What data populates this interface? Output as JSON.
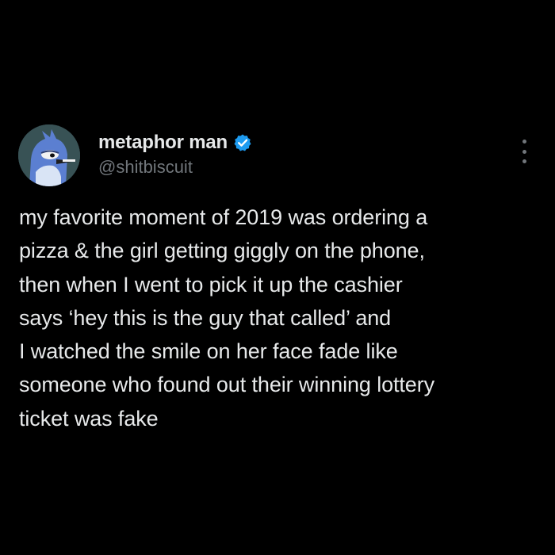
{
  "author": {
    "display_name": "metaphor man",
    "handle": "@shitbiscuit",
    "verified_badge_icon": "verified-check-icon",
    "verified_color": "#1d9bf0"
  },
  "menu": {
    "icon": "more-options-icon"
  },
  "tweet": {
    "lines": [
      "my favorite moment of 2019 was ordering a",
      "pizza & the girl getting giggly on the phone,",
      "then when I went to pick it up the cashier",
      "says ‘hey this is the guy that called’ and",
      "I watched the smile on her face fade like",
      "someone who found out their winning lottery",
      "ticket was fake"
    ]
  },
  "colors": {
    "background": "#000000",
    "primary_text": "#e7e9ea",
    "secondary_text": "#71767b"
  }
}
